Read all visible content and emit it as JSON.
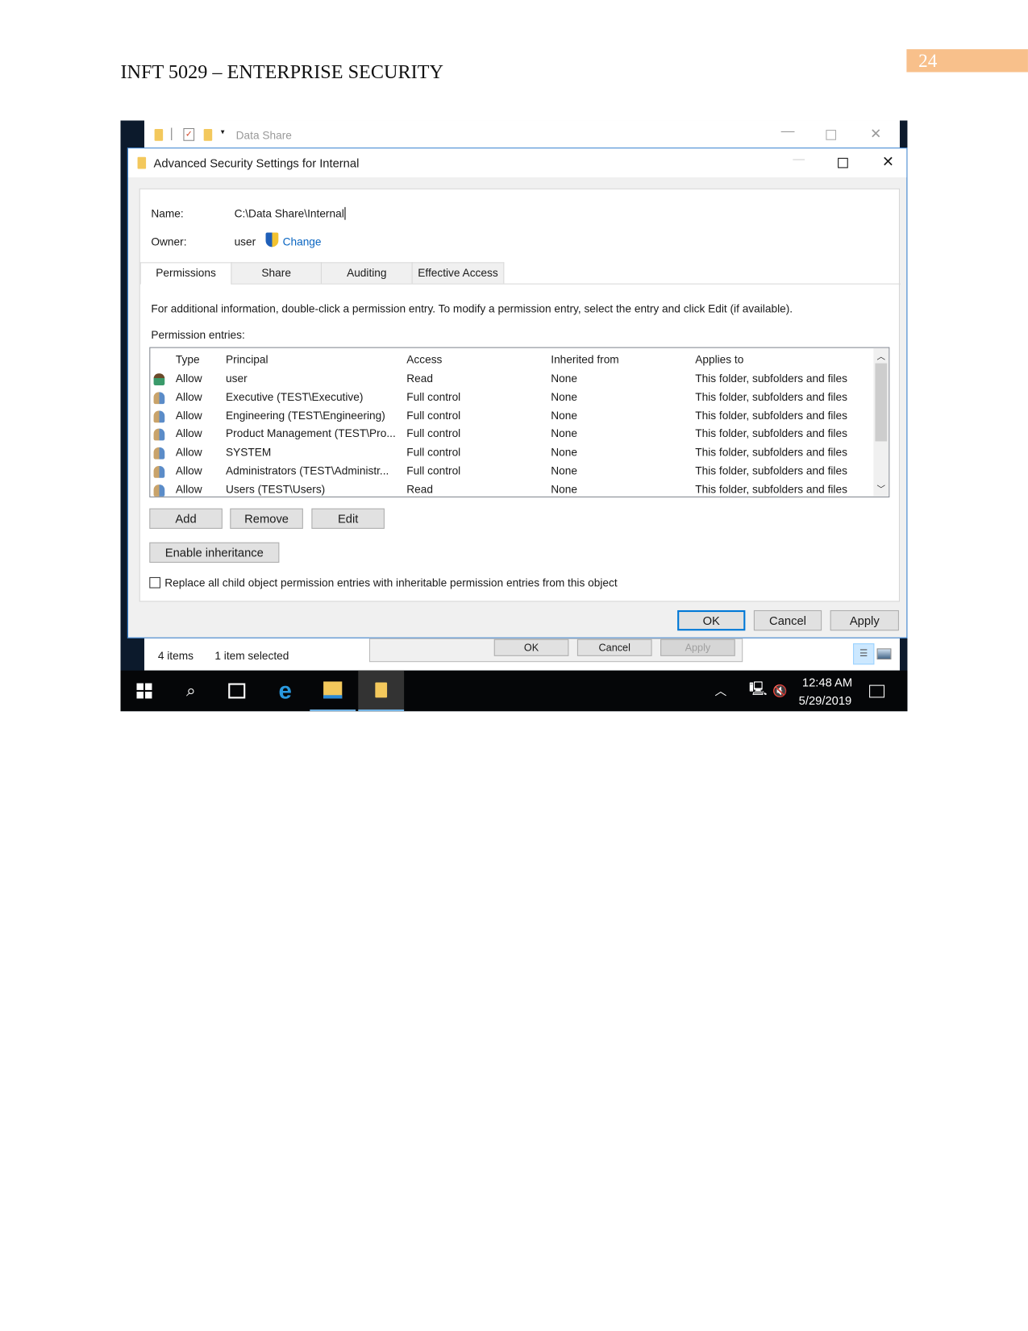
{
  "document": {
    "header": "INFT 5029 – ENTERPRISE SECURITY",
    "page_number": "24",
    "accent_color": "#f8c08b"
  },
  "explorer": {
    "title": "Data Share",
    "status": {
      "items": "4 items",
      "selected": "1 item selected"
    },
    "background_buttons": {
      "ok": "OK",
      "cancel": "Cancel",
      "apply": "Apply"
    }
  },
  "dialog": {
    "title": "Advanced Security Settings for Internal",
    "name_label": "Name:",
    "name_value": "C:\\Data Share\\Internal",
    "owner_label": "Owner:",
    "owner_value": "user",
    "change_link": "Change",
    "tabs": [
      "Permissions",
      "Share",
      "Auditing",
      "Effective Access"
    ],
    "active_tab": "Permissions",
    "info_text": "For additional information, double-click a permission entry. To modify a permission entry, select the entry and click Edit (if available).",
    "entries_label": "Permission entries:",
    "columns": [
      "Type",
      "Principal",
      "Access",
      "Inherited from",
      "Applies to"
    ],
    "rows": [
      {
        "icon": "user-icon",
        "type": "Allow",
        "principal": "user",
        "access": "Read",
        "inherited": "None",
        "applies": "This folder, subfolders and files"
      },
      {
        "icon": "group-icon",
        "type": "Allow",
        "principal": "Executive (TEST\\Executive)",
        "access": "Full control",
        "inherited": "None",
        "applies": "This folder, subfolders and files"
      },
      {
        "icon": "group-icon",
        "type": "Allow",
        "principal": "Engineering (TEST\\Engineering)",
        "access": "Full control",
        "inherited": "None",
        "applies": "This folder, subfolders and files"
      },
      {
        "icon": "group-icon",
        "type": "Allow",
        "principal": "Product Management (TEST\\Pro...",
        "access": "Full control",
        "inherited": "None",
        "applies": "This folder, subfolders and files"
      },
      {
        "icon": "group-icon",
        "type": "Allow",
        "principal": "SYSTEM",
        "access": "Full control",
        "inherited": "None",
        "applies": "This folder, subfolders and files"
      },
      {
        "icon": "group-icon",
        "type": "Allow",
        "principal": "Administrators (TEST\\Administr...",
        "access": "Full control",
        "inherited": "None",
        "applies": "This folder, subfolders and files"
      },
      {
        "icon": "group-icon",
        "type": "Allow",
        "principal": "Users (TEST\\Users)",
        "access": "Read",
        "inherited": "None",
        "applies": "This folder, subfolders and files"
      }
    ],
    "buttons": {
      "add": "Add",
      "remove": "Remove",
      "edit": "Edit",
      "enable_inheritance": "Enable inheritance",
      "ok": "OK",
      "cancel": "Cancel",
      "apply": "Apply"
    },
    "replace_checkbox": {
      "label": "Replace all child object permission entries with inheritable permission entries from this object",
      "checked": false
    }
  },
  "taskbar": {
    "time": "12:48 AM",
    "date": "5/29/2019"
  }
}
